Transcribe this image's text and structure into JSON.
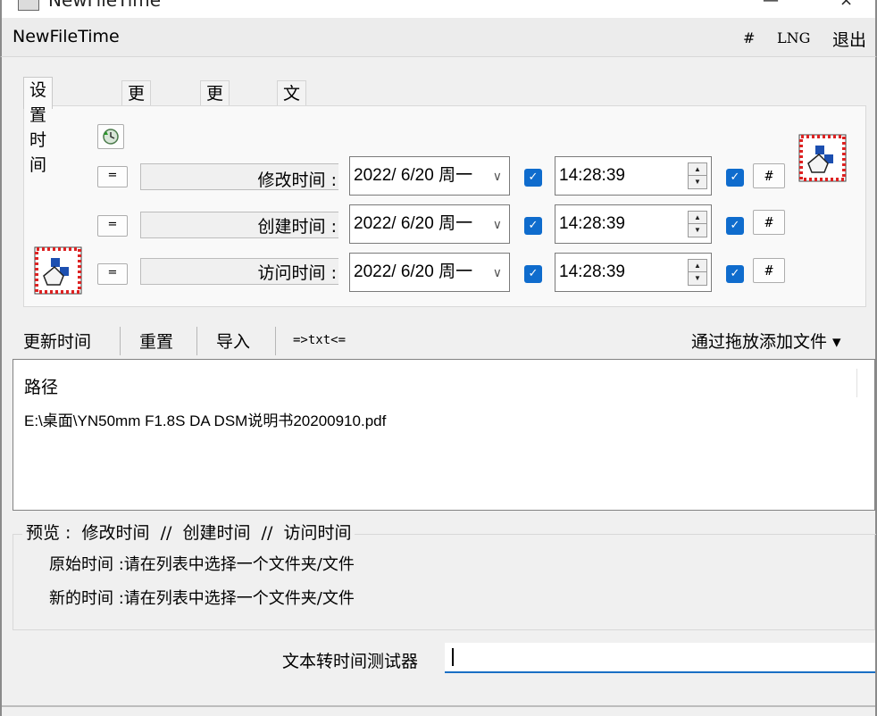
{
  "titlebar": {
    "title": "NewFileTime",
    "minimize": "—",
    "close": "×"
  },
  "menubar": {
    "brand": "NewFileTime",
    "items": [
      "#",
      "LNG",
      "退出"
    ]
  },
  "tabs": [
    "设置时间",
    "更早些",
    "更晚些",
    "文件名转时间"
  ],
  "time_rows": [
    {
      "eq": "=",
      "label": "修改时间 :",
      "date": "2022/ 6/20 周一",
      "time": "14:28:39",
      "hash": "#"
    },
    {
      "eq": "=",
      "label": "创建时间 :",
      "date": "2022/ 6/20 周一",
      "time": "14:28:39",
      "hash": "#"
    },
    {
      "eq": "=",
      "label": "访问时间 :",
      "date": "2022/ 6/20 周一",
      "time": "14:28:39",
      "hash": "#"
    }
  ],
  "icons": {
    "refresh": "refresh-clock-icon",
    "tool": "grid-hand-icon",
    "check": "✓",
    "chev": "∨"
  },
  "toolbar": {
    "update": "更新时间",
    "reset": "重置",
    "import": "导入",
    "txt": "=>txt<=",
    "drag_add": "通过拖放添加文件 ▾"
  },
  "filelist": {
    "header": "路径",
    "rows": [
      "E:\\桌面\\YN50mm F1.8S DA DSM说明书20200910.pdf"
    ]
  },
  "preview": {
    "legend": "预览 :  修改时间  //  创建时间  //  访问时间",
    "original_label": "原始时间 :",
    "original_value": "请在列表中选择一个文件夹/文件",
    "new_label": "新的时间 :",
    "new_value": "请在列表中选择一个文件夹/文件"
  },
  "tester": {
    "label": "文本转时间测试器",
    "value": ""
  },
  "colors": {
    "accent": "#0f6ccd",
    "focus": "#1a6fc4"
  }
}
